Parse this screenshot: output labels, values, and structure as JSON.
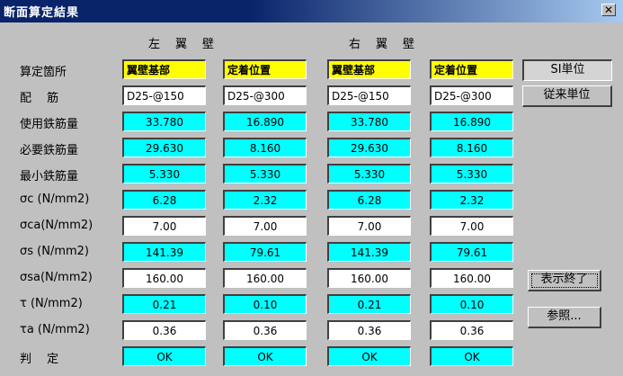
{
  "window": {
    "title": "断面算定結果",
    "close_label": "✕"
  },
  "headers": {
    "left": "左　翼　壁",
    "right": "右　翼　壁"
  },
  "rows": [
    {
      "label": "算定箇所",
      "style": "yellow",
      "values": [
        "翼壁基部",
        "定着位置",
        "翼壁基部",
        "定着位置"
      ]
    },
    {
      "label": "配　 筋",
      "style": "white-left",
      "values": [
        "D25-@150",
        "D25-@300",
        "D25-@150",
        "D25-@300"
      ]
    },
    {
      "label": "使用鉄筋量",
      "style": "cyan",
      "values": [
        "33.780",
        "16.890",
        "33.780",
        "16.890"
      ]
    },
    {
      "label": "必要鉄筋量",
      "style": "cyan",
      "values": [
        "29.630",
        "8.160",
        "29.630",
        "8.160"
      ]
    },
    {
      "label": "最小鉄筋量",
      "style": "cyan",
      "values": [
        "5.330",
        "5.330",
        "5.330",
        "5.330"
      ]
    },
    {
      "label": "σc (N/mm2)",
      "style": "cyan",
      "values": [
        "6.28",
        "2.32",
        "6.28",
        "2.32"
      ]
    },
    {
      "label": "σca(N/mm2)",
      "style": "white",
      "values": [
        "7.00",
        "7.00",
        "7.00",
        "7.00"
      ]
    },
    {
      "label": "σs (N/mm2)",
      "style": "cyan",
      "values": [
        "141.39",
        "79.61",
        "141.39",
        "79.61"
      ]
    },
    {
      "label": "σsa(N/mm2)",
      "style": "white",
      "values": [
        "160.00",
        "160.00",
        "160.00",
        "160.00"
      ]
    },
    {
      "label": "τ (N/mm2)",
      "style": "cyan",
      "values": [
        "0.21",
        "0.10",
        "0.21",
        "0.10"
      ]
    },
    {
      "label": "τa (N/mm2)",
      "style": "white",
      "values": [
        "0.36",
        "0.36",
        "0.36",
        "0.36"
      ]
    },
    {
      "label": "判　 定",
      "style": "cyan",
      "values": [
        "OK",
        "OK",
        "OK",
        "OK"
      ]
    }
  ],
  "buttons": {
    "si_unit": "SI単位",
    "old_unit": "従来単位",
    "close_display": "表示終了",
    "reference": "参照..."
  },
  "colors": {
    "title_bar": "#0a246a",
    "cyan_cell": "#00ffff",
    "yellow_cell": "#ffff00",
    "face": "#c0c0c0"
  }
}
